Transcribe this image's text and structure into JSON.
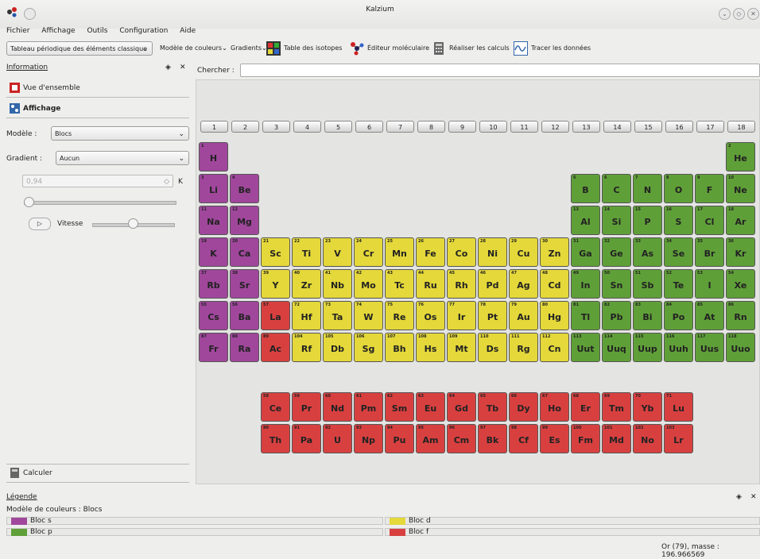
{
  "window": {
    "title": "Kalzium"
  },
  "menu": [
    "Fichier",
    "Affichage",
    "Outils",
    "Configuration",
    "Aide"
  ],
  "toolbar": {
    "table_combo": "Tableau périodique des éléments classique",
    "color_scheme": "Modèle de couleurs",
    "gradients": "Gradients",
    "isotopes": "Table des isotopes",
    "molecular_editor": "Éditeur moléculaire",
    "calculations": "Réaliser les calculs",
    "plot_data": "Tracer les données"
  },
  "panel": {
    "title": "Information",
    "tab_overview": "Vue d'ensemble",
    "tab_display": "Affichage",
    "model_label": "Modèle :",
    "model_value": "Blocs",
    "gradient_label": "Gradient :",
    "gradient_value": "Aucun",
    "spin_value": "0,94",
    "spin_unit": "K",
    "speed_label": "Vitesse",
    "calc_tab": "Calculer"
  },
  "search": {
    "label": "Chercher :"
  },
  "groups": [
    "1",
    "2",
    "3",
    "4",
    "5",
    "6",
    "7",
    "8",
    "9",
    "10",
    "11",
    "12",
    "13",
    "14",
    "15",
    "16",
    "17",
    "18"
  ],
  "block_colors": {
    "s": "#a0479c",
    "p": "#5f9f38",
    "d": "#e4d83a",
    "f": "#d84040"
  },
  "elements": [
    {
      "z": 1,
      "sym": "H",
      "b": "s"
    },
    {
      "z": 2,
      "sym": "He",
      "b": "p"
    },
    {
      "z": 3,
      "sym": "Li",
      "b": "s"
    },
    {
      "z": 4,
      "sym": "Be",
      "b": "s"
    },
    {
      "z": 5,
      "sym": "B",
      "b": "p"
    },
    {
      "z": 6,
      "sym": "C",
      "b": "p"
    },
    {
      "z": 7,
      "sym": "N",
      "b": "p"
    },
    {
      "z": 8,
      "sym": "O",
      "b": "p"
    },
    {
      "z": 9,
      "sym": "F",
      "b": "p"
    },
    {
      "z": 10,
      "sym": "Ne",
      "b": "p"
    },
    {
      "z": 11,
      "sym": "Na",
      "b": "s"
    },
    {
      "z": 12,
      "sym": "Mg",
      "b": "s"
    },
    {
      "z": 13,
      "sym": "Al",
      "b": "p"
    },
    {
      "z": 14,
      "sym": "Si",
      "b": "p"
    },
    {
      "z": 15,
      "sym": "P",
      "b": "p"
    },
    {
      "z": 16,
      "sym": "S",
      "b": "p"
    },
    {
      "z": 17,
      "sym": "Cl",
      "b": "p"
    },
    {
      "z": 18,
      "sym": "Ar",
      "b": "p"
    },
    {
      "z": 19,
      "sym": "K",
      "b": "s"
    },
    {
      "z": 20,
      "sym": "Ca",
      "b": "s"
    },
    {
      "z": 21,
      "sym": "Sc",
      "b": "d"
    },
    {
      "z": 22,
      "sym": "Ti",
      "b": "d"
    },
    {
      "z": 23,
      "sym": "V",
      "b": "d"
    },
    {
      "z": 24,
      "sym": "Cr",
      "b": "d"
    },
    {
      "z": 25,
      "sym": "Mn",
      "b": "d"
    },
    {
      "z": 26,
      "sym": "Fe",
      "b": "d"
    },
    {
      "z": 27,
      "sym": "Co",
      "b": "d"
    },
    {
      "z": 28,
      "sym": "Ni",
      "b": "d"
    },
    {
      "z": 29,
      "sym": "Cu",
      "b": "d"
    },
    {
      "z": 30,
      "sym": "Zn",
      "b": "d"
    },
    {
      "z": 31,
      "sym": "Ga",
      "b": "p"
    },
    {
      "z": 32,
      "sym": "Ge",
      "b": "p"
    },
    {
      "z": 33,
      "sym": "As",
      "b": "p"
    },
    {
      "z": 34,
      "sym": "Se",
      "b": "p"
    },
    {
      "z": 35,
      "sym": "Br",
      "b": "p"
    },
    {
      "z": 36,
      "sym": "Kr",
      "b": "p"
    },
    {
      "z": 37,
      "sym": "Rb",
      "b": "s"
    },
    {
      "z": 38,
      "sym": "Sr",
      "b": "s"
    },
    {
      "z": 39,
      "sym": "Y",
      "b": "d"
    },
    {
      "z": 40,
      "sym": "Zr",
      "b": "d"
    },
    {
      "z": 41,
      "sym": "Nb",
      "b": "d"
    },
    {
      "z": 42,
      "sym": "Mo",
      "b": "d"
    },
    {
      "z": 43,
      "sym": "Tc",
      "b": "d"
    },
    {
      "z": 44,
      "sym": "Ru",
      "b": "d"
    },
    {
      "z": 45,
      "sym": "Rh",
      "b": "d"
    },
    {
      "z": 46,
      "sym": "Pd",
      "b": "d"
    },
    {
      "z": 47,
      "sym": "Ag",
      "b": "d"
    },
    {
      "z": 48,
      "sym": "Cd",
      "b": "d"
    },
    {
      "z": 49,
      "sym": "In",
      "b": "p"
    },
    {
      "z": 50,
      "sym": "Sn",
      "b": "p"
    },
    {
      "z": 51,
      "sym": "Sb",
      "b": "p"
    },
    {
      "z": 52,
      "sym": "Te",
      "b": "p"
    },
    {
      "z": 53,
      "sym": "I",
      "b": "p"
    },
    {
      "z": 54,
      "sym": "Xe",
      "b": "p"
    },
    {
      "z": 55,
      "sym": "Cs",
      "b": "s"
    },
    {
      "z": 56,
      "sym": "Ba",
      "b": "s"
    },
    {
      "z": 57,
      "sym": "La",
      "b": "f"
    },
    {
      "z": 72,
      "sym": "Hf",
      "b": "d"
    },
    {
      "z": 73,
      "sym": "Ta",
      "b": "d"
    },
    {
      "z": 74,
      "sym": "W",
      "b": "d"
    },
    {
      "z": 75,
      "sym": "Re",
      "b": "d"
    },
    {
      "z": 76,
      "sym": "Os",
      "b": "d"
    },
    {
      "z": 77,
      "sym": "Ir",
      "b": "d"
    },
    {
      "z": 78,
      "sym": "Pt",
      "b": "d"
    },
    {
      "z": 79,
      "sym": "Au",
      "b": "d"
    },
    {
      "z": 80,
      "sym": "Hg",
      "b": "d"
    },
    {
      "z": 81,
      "sym": "Tl",
      "b": "p"
    },
    {
      "z": 82,
      "sym": "Pb",
      "b": "p"
    },
    {
      "z": 83,
      "sym": "Bi",
      "b": "p"
    },
    {
      "z": 84,
      "sym": "Po",
      "b": "p"
    },
    {
      "z": 85,
      "sym": "At",
      "b": "p"
    },
    {
      "z": 86,
      "sym": "Rn",
      "b": "p"
    },
    {
      "z": 87,
      "sym": "Fr",
      "b": "s"
    },
    {
      "z": 88,
      "sym": "Ra",
      "b": "s"
    },
    {
      "z": 89,
      "sym": "Ac",
      "b": "f"
    },
    {
      "z": 104,
      "sym": "Rf",
      "b": "d"
    },
    {
      "z": 105,
      "sym": "Db",
      "b": "d"
    },
    {
      "z": 106,
      "sym": "Sg",
      "b": "d"
    },
    {
      "z": 107,
      "sym": "Bh",
      "b": "d"
    },
    {
      "z": 108,
      "sym": "Hs",
      "b": "d"
    },
    {
      "z": 109,
      "sym": "Mt",
      "b": "d"
    },
    {
      "z": 110,
      "sym": "Ds",
      "b": "d"
    },
    {
      "z": 111,
      "sym": "Rg",
      "b": "d"
    },
    {
      "z": 112,
      "sym": "Cn",
      "b": "d"
    },
    {
      "z": 113,
      "sym": "Uut",
      "b": "p"
    },
    {
      "z": 114,
      "sym": "Uuq",
      "b": "p"
    },
    {
      "z": 115,
      "sym": "Uup",
      "b": "p"
    },
    {
      "z": 116,
      "sym": "Uuh",
      "b": "p"
    },
    {
      "z": 117,
      "sym": "Uus",
      "b": "p"
    },
    {
      "z": 118,
      "sym": "Uuo",
      "b": "p"
    }
  ],
  "lanthanides": [
    {
      "z": 58,
      "sym": "Ce"
    },
    {
      "z": 59,
      "sym": "Pr"
    },
    {
      "z": 60,
      "sym": "Nd"
    },
    {
      "z": 61,
      "sym": "Pm"
    },
    {
      "z": 62,
      "sym": "Sm"
    },
    {
      "z": 63,
      "sym": "Eu"
    },
    {
      "z": 64,
      "sym": "Gd"
    },
    {
      "z": 65,
      "sym": "Tb"
    },
    {
      "z": 66,
      "sym": "Dy"
    },
    {
      "z": 67,
      "sym": "Ho"
    },
    {
      "z": 68,
      "sym": "Er"
    },
    {
      "z": 69,
      "sym": "Tm"
    },
    {
      "z": 70,
      "sym": "Yb"
    },
    {
      "z": 71,
      "sym": "Lu"
    }
  ],
  "actinides": [
    {
      "z": 90,
      "sym": "Th"
    },
    {
      "z": 91,
      "sym": "Pa"
    },
    {
      "z": 92,
      "sym": "U"
    },
    {
      "z": 93,
      "sym": "Np"
    },
    {
      "z": 94,
      "sym": "Pu"
    },
    {
      "z": 95,
      "sym": "Am"
    },
    {
      "z": 96,
      "sym": "Cm"
    },
    {
      "z": 97,
      "sym": "Bk"
    },
    {
      "z": 98,
      "sym": "Cf"
    },
    {
      "z": 99,
      "sym": "Es"
    },
    {
      "z": 100,
      "sym": "Fm"
    },
    {
      "z": 101,
      "sym": "Md"
    },
    {
      "z": 102,
      "sym": "No"
    },
    {
      "z": 103,
      "sym": "Lr"
    }
  ],
  "legend": {
    "title": "Légende",
    "model": "Modèle de couleurs : Blocs",
    "s": "Bloc s",
    "p": "Bloc p",
    "d": "Bloc d",
    "f": "Bloc f"
  },
  "status": {
    "text": "Or (79), masse : 196.966569"
  }
}
